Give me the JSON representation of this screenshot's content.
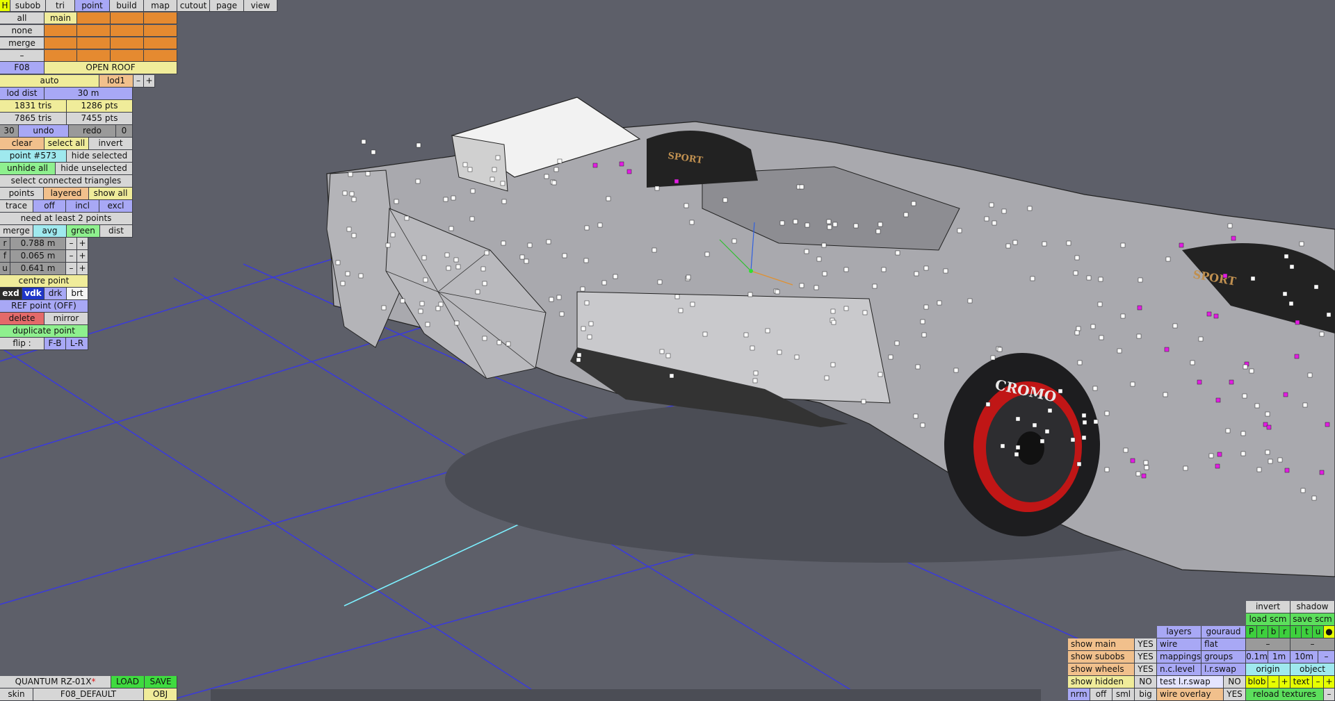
{
  "menu": {
    "h": "H",
    "tabs": [
      "subob",
      "tri",
      "point",
      "build",
      "map",
      "cutout",
      "page",
      "view"
    ],
    "active": "point"
  },
  "selection": {
    "all": "all",
    "main": "main",
    "none": "none",
    "merge": "merge",
    "dash": "–"
  },
  "model": {
    "code": "F08",
    "name": "OPEN ROOF"
  },
  "lod": {
    "mode": "auto",
    "level": "lod1",
    "minus": "–",
    "plus": "+",
    "dist_label": "lod dist",
    "dist_value": "30 m"
  },
  "stats": {
    "tris1": "1831 tris",
    "pts1": "1286 pts",
    "tris2": "7865 tris",
    "pts2": "7455 pts"
  },
  "history": {
    "count": "30",
    "undo": "undo",
    "redo": "redo",
    "redo_count": "0"
  },
  "edit": {
    "clear": "clear",
    "select_all": "select all",
    "invert": "invert",
    "point_label": "point #573",
    "hide_selected": "hide selected",
    "unhide_all": "unhide all",
    "hide_unselected": "hide unselected",
    "select_connected": "select connected triangles"
  },
  "view_mode": {
    "points": "points",
    "layered": "layered",
    "show_all": "show all"
  },
  "trace": {
    "trace": "trace",
    "off": "off",
    "incl": "incl",
    "excl": "excl"
  },
  "status": {
    "message": "need at least 2 points"
  },
  "merge_row": {
    "merge": "merge",
    "avg": "avg",
    "green": "green",
    "dist": "dist"
  },
  "coords": {
    "r_label": "r",
    "r_value": "0.788 m",
    "f_label": "f",
    "f_value": "0.065 m",
    "u_label": "u",
    "u_value": "0.641 m",
    "minus": "–",
    "plus": "+"
  },
  "point_ops": {
    "centre": "centre point",
    "exd": "exd",
    "vdk": "vdk",
    "drk": "drk",
    "brt": "brt",
    "ref": "REF point (OFF)",
    "delete": "delete",
    "mirror": "mirror",
    "duplicate": "duplicate point",
    "flip": "flip :",
    "fb": "F-B",
    "lr": "L-R"
  },
  "file": {
    "name": "QUANTUM RZ-01X",
    "modified_mark": "*",
    "load": "LOAD",
    "save": "SAVE",
    "skin_label": "skin",
    "skin_value": "F08_DEFAULT",
    "obj": "OBJ"
  },
  "render": {
    "invert": "invert",
    "shadow": "shadow",
    "load_scm": "load scm",
    "save_scm": "save scm",
    "layer_flags": [
      "P",
      "r",
      "b",
      "r",
      "l",
      "t",
      "u",
      "●"
    ],
    "show_main": "show main",
    "show_subobs": "show subobs",
    "show_wheels": "show wheels",
    "show_hidden": "show hidden",
    "yes": "YES",
    "no": "NO",
    "layers": "layers",
    "gouraud": "gouraud",
    "wire": "wire",
    "flat": "flat",
    "mappings": "mappings",
    "groups": "groups",
    "nclevel": "n.c.level",
    "lrswap": "l.r.swap",
    "test_lrswap": "test l.r.swap",
    "dash": "–",
    "grid": [
      "0.1m",
      "1m",
      "10m"
    ],
    "origin": "origin",
    "object": "object",
    "blob": "blob",
    "minus": "–",
    "plus": "+",
    "text": "text",
    "sizes": [
      "nrm",
      "off",
      "sml",
      "big"
    ],
    "wire_overlay": "wire overlay",
    "reload": "reload textures"
  },
  "viewport": {
    "tire_brand": "CROMO",
    "tire_logo": "SPORT"
  },
  "colors": {
    "background": "#5d5f69",
    "grid": "#3b3bd8",
    "axis": "#7df0ff",
    "selected_point": "#e21ce2"
  }
}
